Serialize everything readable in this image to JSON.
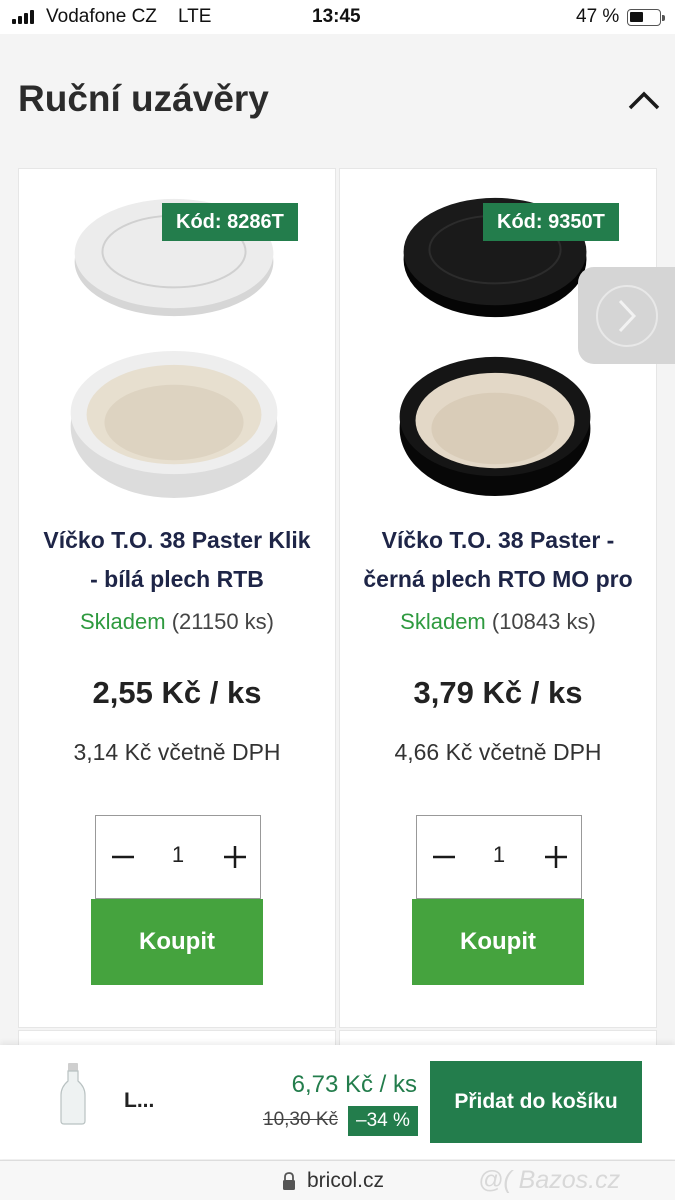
{
  "status_bar": {
    "carrier": "Vodafone CZ",
    "network": "LTE",
    "time": "13:45",
    "battery": "47 %"
  },
  "section": {
    "title": "Ruční uzávěry",
    "collapse_icon": "chevron-up-icon"
  },
  "products": [
    {
      "code": "Kód: 8286T",
      "name_line1": "Víčko T.O. 38 Paster Klik",
      "name_line2": "- bílá plech RTB",
      "stock_label": "Skladem",
      "stock_count": "(21150 ks)",
      "price": "2,55 Kč / ks",
      "price_vat": "3,14 Kč včetně DPH",
      "quantity": "1",
      "buy_label": "Koupit",
      "lid_color": "#e2e2e2"
    },
    {
      "code": "Kód: 9350T",
      "name_line1": "Víčko T.O. 38 Paster -",
      "name_line2": "černá plech RTO MO pro",
      "stock_label": "Skladem",
      "stock_count": "(10843 ks)",
      "price": "3,79 Kč / ks",
      "price_vat": "4,66 Kč včetně DPH",
      "quantity": "1",
      "buy_label": "Koupit",
      "lid_color": "#111111"
    }
  ],
  "carousel": {
    "next_icon": "chevron-right-icon"
  },
  "sticky_bar": {
    "product_name": "L...",
    "sale_price": "6,73 Kč / ks",
    "old_price": "10,30 Kč",
    "discount": "–34 %",
    "add_to_cart_label": "Přidat do košíku"
  },
  "url_bar": {
    "url": "bricol.cz",
    "watermark": "@( Bazos.cz"
  },
  "colors": {
    "brand_green": "#237d4c",
    "buy_green": "#45a33e",
    "stock_green": "#2e9a3f",
    "title_navy": "#1e2547"
  }
}
